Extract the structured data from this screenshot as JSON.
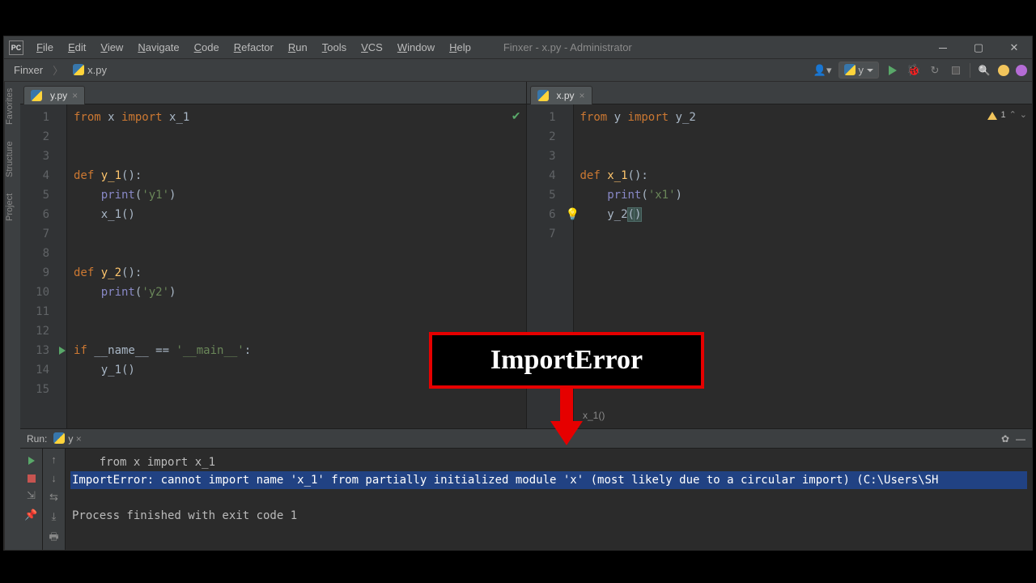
{
  "window": {
    "title": "Finxer - x.py - Administrator"
  },
  "menu": {
    "items": [
      "File",
      "Edit",
      "View",
      "Navigate",
      "Code",
      "Refactor",
      "Run",
      "Tools",
      "VCS",
      "Window",
      "Help"
    ]
  },
  "breadcrumb": {
    "project": "Finxer",
    "file": "x.py"
  },
  "run_config": {
    "name": "y"
  },
  "left_sidebar": {
    "items": [
      "Project",
      "Structure",
      "Favorites"
    ]
  },
  "editor_left": {
    "tab": "y.py",
    "status": "ok",
    "line_count": 15,
    "code_lines": [
      {
        "n": 1,
        "html": "<span class='kw'>from</span> x <span class='kw'>import</span> x_1"
      },
      {
        "n": 2,
        "html": ""
      },
      {
        "n": 3,
        "html": ""
      },
      {
        "n": 4,
        "html": "<span class='kw'>def</span> <span class='fn'>y_1</span>():"
      },
      {
        "n": 5,
        "html": "    <span class='builtin'>print</span>(<span class='str'>'y1'</span>)"
      },
      {
        "n": 6,
        "html": "    x_1()"
      },
      {
        "n": 7,
        "html": ""
      },
      {
        "n": 8,
        "html": ""
      },
      {
        "n": 9,
        "html": "<span class='kw'>def</span> <span class='fn'>y_2</span>():"
      },
      {
        "n": 10,
        "html": "    <span class='builtin'>print</span>(<span class='str'>'y2'</span>)"
      },
      {
        "n": 11,
        "html": ""
      },
      {
        "n": 12,
        "html": ""
      },
      {
        "n": 13,
        "html": "<span class='kw'>if</span> __name__ == <span class='str'>'__main__'</span>:"
      },
      {
        "n": 14,
        "html": "    y_1()"
      },
      {
        "n": 15,
        "html": ""
      }
    ]
  },
  "editor_right": {
    "tab": "x.py",
    "warnings": "1",
    "line_count": 7,
    "code_lines": [
      {
        "n": 1,
        "html": "<span class='kw'>from</span> y <span class='kw'>import</span> y_2"
      },
      {
        "n": 2,
        "html": ""
      },
      {
        "n": 3,
        "html": ""
      },
      {
        "n": 4,
        "html": "<span class='kw'>def</span> <span class='fn'>x_1</span>():"
      },
      {
        "n": 5,
        "html": "    <span class='builtin'>print</span>(<span class='str'>'x1'</span>)"
      },
      {
        "n": 6,
        "html": "    y_2<span class='hl-paren'>(</span><span class='hl-paren'>)</span>",
        "bulb": true
      },
      {
        "n": 7,
        "html": ""
      }
    ]
  },
  "breadcrumb2": "x_1()",
  "run_panel": {
    "title": "Run:",
    "config": "y",
    "lines": [
      {
        "cls": "",
        "text": "    from x import x_1"
      },
      {
        "cls": "hl err",
        "text": "ImportError: cannot import name 'x_1' from partially initialized module 'x' (most likely due to a circular import) (C:\\Users\\SH"
      },
      {
        "cls": "",
        "text": ""
      },
      {
        "cls": "",
        "text": "Process finished with exit code 1"
      }
    ]
  },
  "annotation": "ImportError"
}
